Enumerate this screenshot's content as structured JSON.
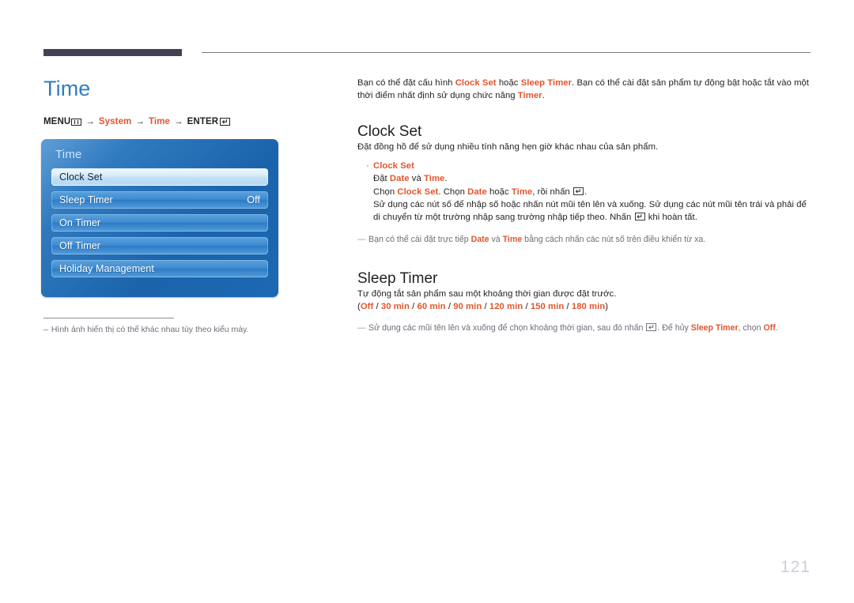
{
  "page": {
    "number": "121",
    "title": "Time",
    "title_color": "#2f7cc4",
    "accent_color": "#e2562c"
  },
  "breadcrumb": {
    "menu_label": "MENU",
    "menu_icon": "menu-bars-icon",
    "arrow": "→",
    "step_system": "System",
    "step_time": "Time",
    "enter_label": "ENTER",
    "enter_icon": "enter-return-icon",
    "enter_glyph": "↵"
  },
  "osd": {
    "title": "Time",
    "items": [
      {
        "label": "Clock Set",
        "value": "",
        "selected": true
      },
      {
        "label": "Sleep Timer",
        "value": "Off",
        "selected": false
      },
      {
        "label": "On Timer",
        "value": "",
        "selected": false
      },
      {
        "label": "Off Timer",
        "value": "",
        "selected": false
      },
      {
        "label": "Holiday Management",
        "value": "",
        "selected": false
      }
    ]
  },
  "left_note": {
    "dash": "–",
    "text": "Hình ảnh hiển thị có thể khác nhau tùy theo kiểu máy."
  },
  "intro": {
    "p1_a": "Bạn có thể đặt cấu hình ",
    "p1_t1": "Clock Set",
    "p1_b": " hoặc ",
    "p1_t2": "Sleep Timer",
    "p1_c": ". Bạn có thể cài đặt sản phẩm tự động bật hoặc tắt vào một thời điểm nhất định sử dụng chức năng ",
    "p1_t3": "Timer",
    "p1_d": "."
  },
  "clock_set": {
    "heading": "Clock Set",
    "lead": "Đặt đồng hồ để sử dụng nhiều tính năng hẹn giờ khác nhau của sản phẩm.",
    "bullet_dot": "·",
    "bullet_title": "Clock Set",
    "line1_a": "Đặt ",
    "line1_t1": "Date",
    "line1_b": " và ",
    "line1_t2": "Time",
    "line1_c": ".",
    "line2_a": "Chọn ",
    "line2_t1": "Clock Set",
    "line2_b": ". Chọn ",
    "line2_t2": "Date",
    "line2_c": " hoặc ",
    "line2_t3": "Time",
    "line2_d": ", rồi nhấn ",
    "line2_e": ".",
    "line3_a": "Sử dụng các nút số để nhập số hoặc nhấn nút mũi tên lên và xuống. Sử dụng các nút mũi tên trái và phải để di chuyển từ một trường nhập sang trường nhập tiếp theo. Nhấn ",
    "line3_b": " khi hoàn tất.",
    "note_dash": "—",
    "note_a": "Bạn có thể cài đặt trực tiếp ",
    "note_t1": "Date",
    "note_b": " và ",
    "note_t2": "Time",
    "note_c": " bằng cách nhấn các nút số trên điều khiển từ xa."
  },
  "sleep_timer": {
    "heading": "Sleep Timer",
    "lead": "Tự động tắt sản phẩm sau một khoảng thời gian được đặt trước.",
    "options_open": "(",
    "options": [
      "Off",
      "30 min",
      "60 min",
      "90 min",
      "120 min",
      "150 min",
      "180 min"
    ],
    "options_sep": " / ",
    "options_close": ")",
    "note_dash": "—",
    "note_a": "Sử dụng các mũi tên lên và xuống để chọn khoảng thời gian, sau đó nhấn ",
    "note_b": ". Để hủy ",
    "note_t1": "Sleep Timer",
    "note_c": ", chọn ",
    "note_t2": "Off",
    "note_d": "."
  }
}
